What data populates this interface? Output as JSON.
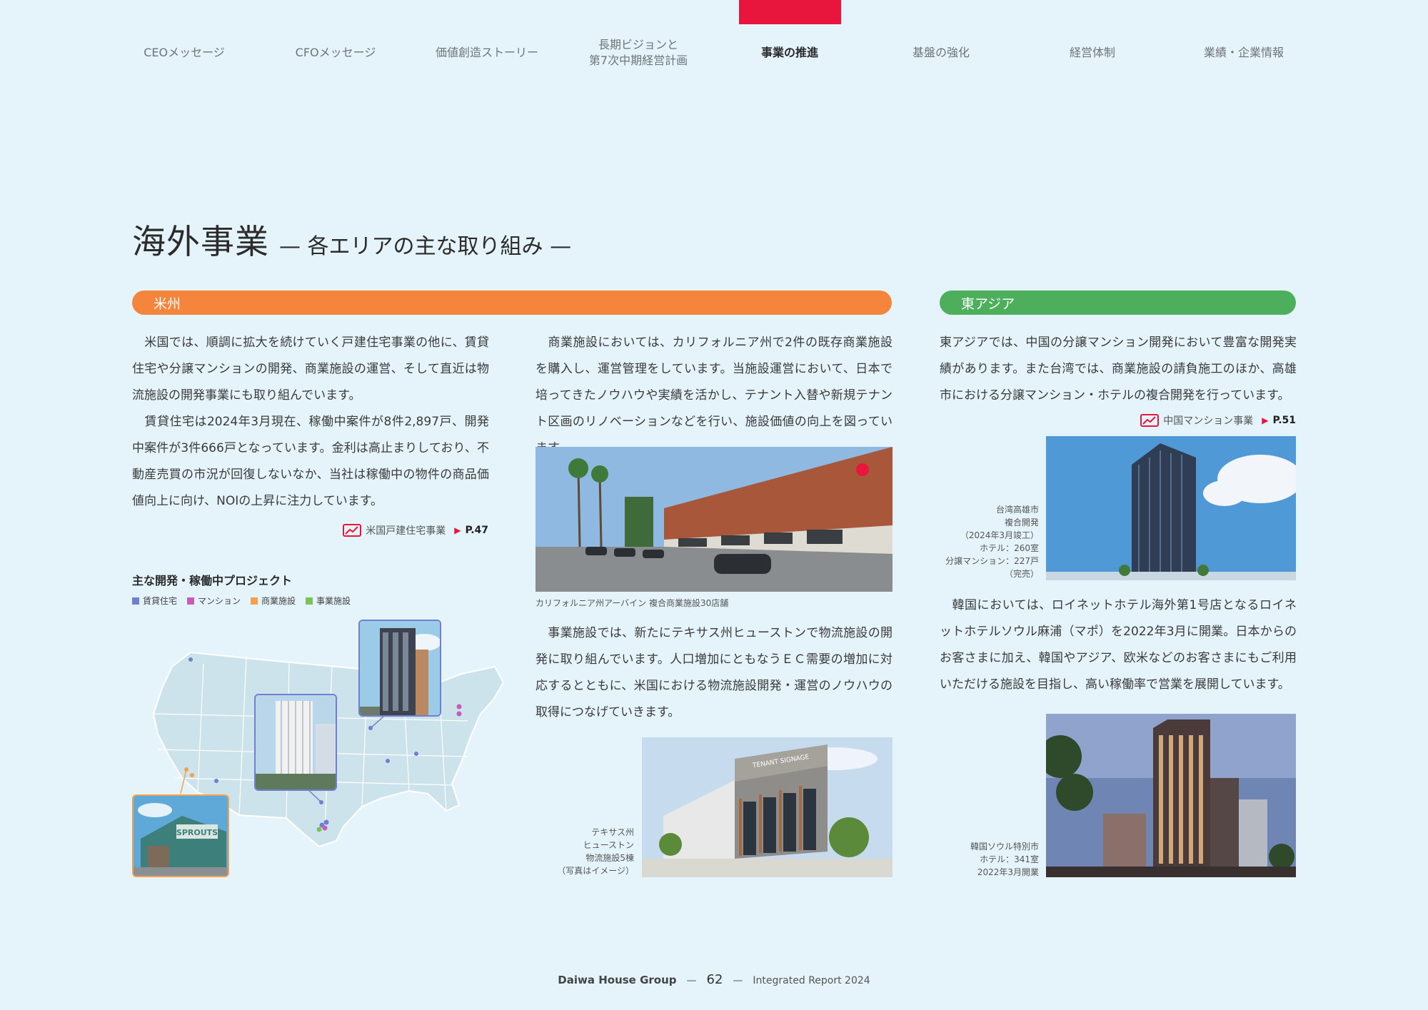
{
  "nav": {
    "tabs": [
      {
        "label": "CEOメッセージ"
      },
      {
        "label": "CFOメッセージ"
      },
      {
        "label": "価値創造ストーリー"
      },
      {
        "label": "長期ビジョンと\n第7次中期経営計画"
      },
      {
        "label": "事業の推進"
      },
      {
        "label": "基盤の強化"
      },
      {
        "label": "経営体制"
      },
      {
        "label": "業績・企業情報"
      }
    ],
    "active_index": 4,
    "accent_color": "#e8163c"
  },
  "title": {
    "main": "海外事業",
    "sub": "— 各エリアの主な取り組み —"
  },
  "us": {
    "bar_label": "米州",
    "bar_color": "#f5843c",
    "para1": "　米国では、順調に拡大を続けていく戸建住宅事業の他に、賃貸住宅や分譲マンションの開発、商業施設の運営、そして直近は物流施設の開発事業にも取り組んでいます。",
    "para2": "　賃貸住宅は2024年3月現在、稼働中案件が8件2,897戸、開発中案件が3件666戸となっています。金利は高止まりしており、不動産売買の市況が回復しないなか、当社は稼働中の物件の商品価値向上に向け、NOIの上昇に注力しています。",
    "ref_label": "米国戸建住宅事業",
    "ref_page": "P.47",
    "para3": "　商業施設においては、カリフォルニア州で2件の既存商業施設を購入し、運営管理をしています。当施設運営において、日本で培ってきたノウハウや実績を活かし、テナント入替や新規テナント区画のリノベーションなどを行い、施設価値の向上を図っています。",
    "photo1_caption": "カリフォルニア州アーバイン 複合商業施設30店舗",
    "para4": "　事業施設では、新たにテキサス州ヒューストンで物流施設の開発に取り組んでいます。人口増加にともなうＥＣ需要の増加に対応するとともに、米国における物流施設開発・運営のノウハウの取得につなげていきます。",
    "photo2_caption": "テキサス州\nヒューストン\n物流施設5棟\n（写真はイメージ）",
    "map_heading": "主な開発・稼働中プロジェクト",
    "legend": [
      {
        "label": "賃貸住宅",
        "color": "#6f7fd1"
      },
      {
        "label": "マンション",
        "color": "#c65bb8"
      },
      {
        "label": "商業施設",
        "color": "#f5a04a"
      },
      {
        "label": "事業施設",
        "color": "#7cc25a"
      }
    ],
    "storefront_sign": "SPROUTS",
    "logistics_sign": "TENANT SIGNAGE"
  },
  "east_asia": {
    "bar_label": "東アジア",
    "bar_color": "#4daf5c",
    "para1": "東アジアでは、中国の分譲マンション開発において豊富な開発実績があります。また台湾では、商業施設の請負施工のほか、高雄市における分譲マンション・ホテルの複合開発を行っています。",
    "ref_label": "中国マンション事業",
    "ref_page": "P.51",
    "photo1_caption": "台湾高雄市\n複合開発\n（2024年3月竣工）\nホテル：260室\n分譲マンション：227戸\n（完売）",
    "para2": "　韓国においては、ロイネットホテル海外第1号店となるロイネットホテルソウル麻浦（マポ）を2022年3月に開業。日本からのお客さまに加え、韓国やアジア、欧米などのお客さまにもご利用いただける施設を目指し、高い稼働率で営業を展開しています。",
    "photo2_caption": "韓国ソウル特別市\nホテル：341室\n2022年3月開業"
  },
  "footer": {
    "brand": "Daiwa House Group",
    "dash": "—",
    "page": "62",
    "report": "Integrated Report 2024"
  }
}
